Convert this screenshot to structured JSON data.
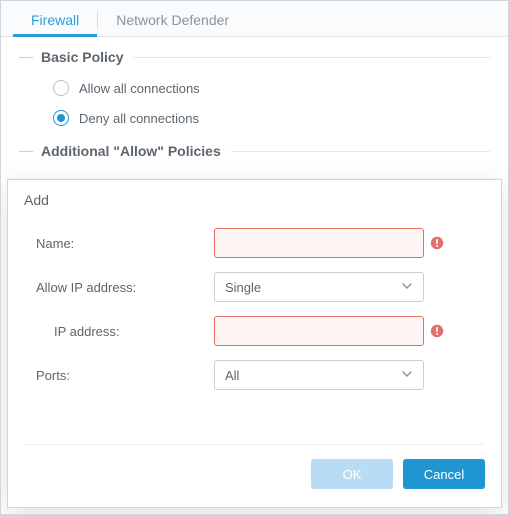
{
  "tabs": [
    {
      "label": "Firewall",
      "active": true
    },
    {
      "label": "Network Defender",
      "active": false
    }
  ],
  "sections": {
    "basic": {
      "title": "Basic Policy",
      "options": [
        {
          "label": "Allow all connections",
          "selected": false
        },
        {
          "label": "Deny all connections",
          "selected": true
        }
      ]
    },
    "additional": {
      "title": "Additional \"Allow\" Policies"
    }
  },
  "dialog": {
    "title": "Add",
    "fields": {
      "name": {
        "label": "Name:",
        "value": "",
        "error": true
      },
      "allow_ip": {
        "label": "Allow IP address:",
        "value": "Single"
      },
      "ip": {
        "label": "IP address:",
        "value": "",
        "error": true
      },
      "ports": {
        "label": "Ports:",
        "value": "All"
      }
    },
    "buttons": {
      "ok": "OK",
      "cancel": "Cancel"
    }
  }
}
